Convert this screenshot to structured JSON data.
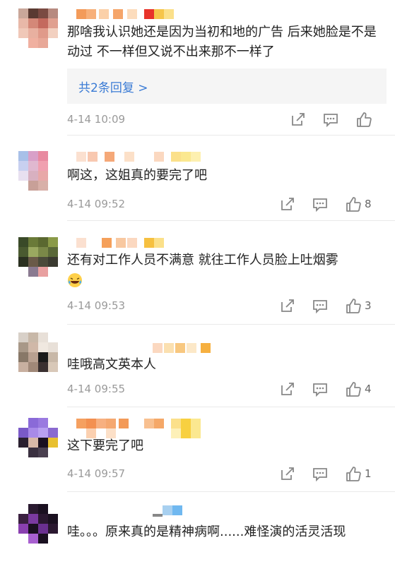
{
  "comments": [
    {
      "text": "那啥我认识她还是因为当初和地的广告 后来她脸是不是动过 不一样但又说不出来那不一样了",
      "time": "4-14 10:09",
      "reply_label": "共2条回复 >",
      "likes": ""
    },
    {
      "text": "啊这，这姐真的要完了吧",
      "time": "4-14 09:52",
      "likes": "8"
    },
    {
      "text": "还有对工作人员不满意 就往工作人员脸上吐烟雾",
      "time": "4-14 09:53",
      "likes": "3"
    },
    {
      "text": "哇哦高文英本人",
      "time": "4-14 09:55",
      "likes": "4"
    },
    {
      "text": "这下要完了吧",
      "time": "4-14 09:57",
      "likes": "1"
    },
    {
      "text": "哇。。。原来真的是精神病啊......难怪演的活灵活现",
      "time": "",
      "likes": ""
    }
  ],
  "icons": {
    "share": "share-icon",
    "comment": "comment-icon",
    "like": "thumbs-up-icon",
    "emoji": "laughing-tears-emoji"
  },
  "colors": {
    "link": "#3a7bd5",
    "meta": "#9a9a9a",
    "divider": "#eaeaea"
  }
}
